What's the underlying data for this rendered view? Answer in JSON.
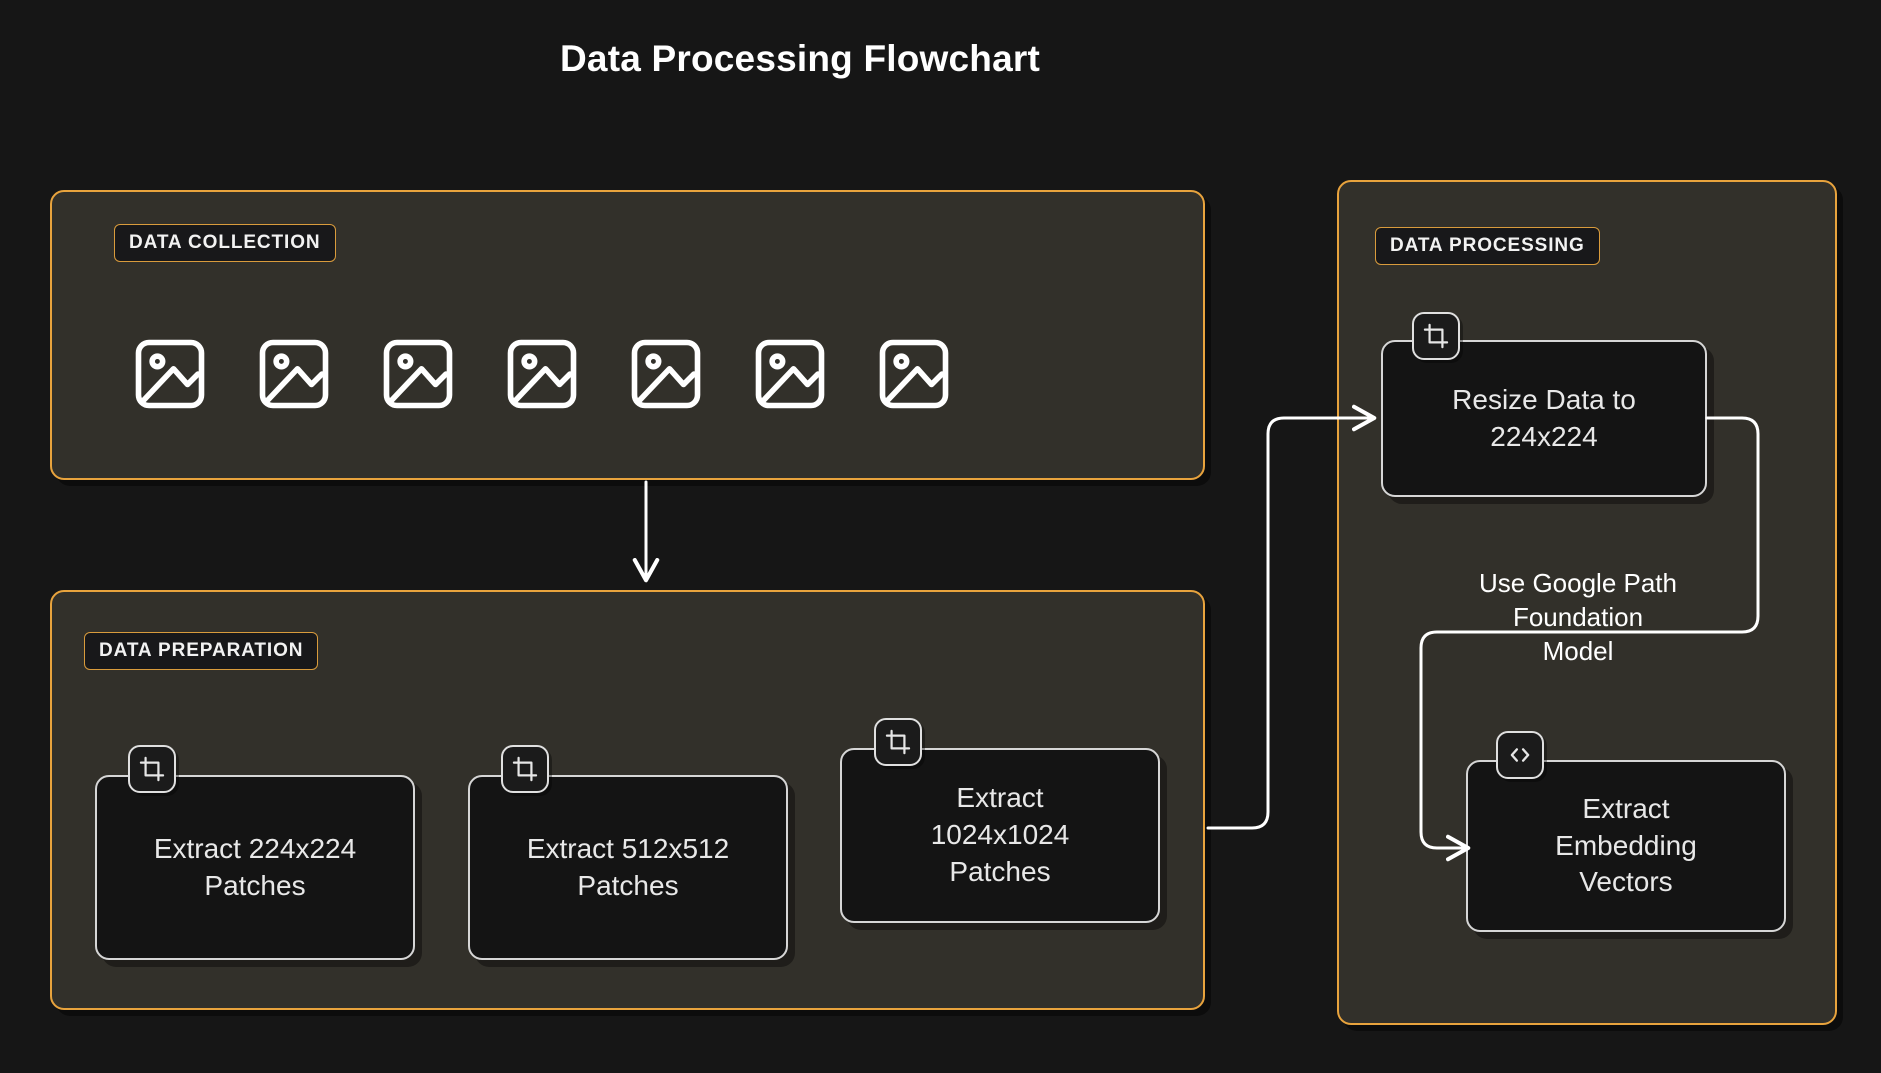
{
  "page": {
    "title": "Data Processing Flowchart",
    "background_color": "#161616"
  },
  "colors": {
    "subgraph_border": "#e8a33d",
    "subgraph_fill": "#32302a",
    "node_fill": "#141414",
    "node_border": "#d6d6d6",
    "edge_stroke": "#ffffff",
    "text": "#e8e8e8"
  },
  "subgraphs": {
    "collection": {
      "label": "DATA COLLECTION",
      "icons": [
        "image-icon",
        "image-icon",
        "image-icon",
        "image-icon",
        "image-icon",
        "image-icon",
        "image-icon"
      ],
      "icon_count": "7"
    },
    "preparation": {
      "label": "DATA PREPARATION",
      "nodes": [
        {
          "id": "patch224",
          "label": "Extract 224x224\nPatches",
          "icon": "crop-icon"
        },
        {
          "id": "patch512",
          "label": "Extract 512x512\nPatches",
          "icon": "crop-icon"
        },
        {
          "id": "patch1024",
          "label": "Extract\n1024x1024\nPatches",
          "icon": "crop-icon"
        }
      ]
    },
    "processing": {
      "label": "DATA PROCESSING",
      "nodes": [
        {
          "id": "resize",
          "label": "Resize Data to\n224x224",
          "icon": "crop-icon"
        },
        {
          "id": "embedding",
          "label": "Extract\nEmbedding\nVectors",
          "icon": "code-icon"
        }
      ]
    }
  },
  "edges": [
    {
      "id": "collection-to-preparation",
      "label": ""
    },
    {
      "id": "preparation-to-resize",
      "label": ""
    },
    {
      "id": "resize-to-embedding",
      "label": "Use Google Path\nFoundation\nModel"
    }
  ]
}
